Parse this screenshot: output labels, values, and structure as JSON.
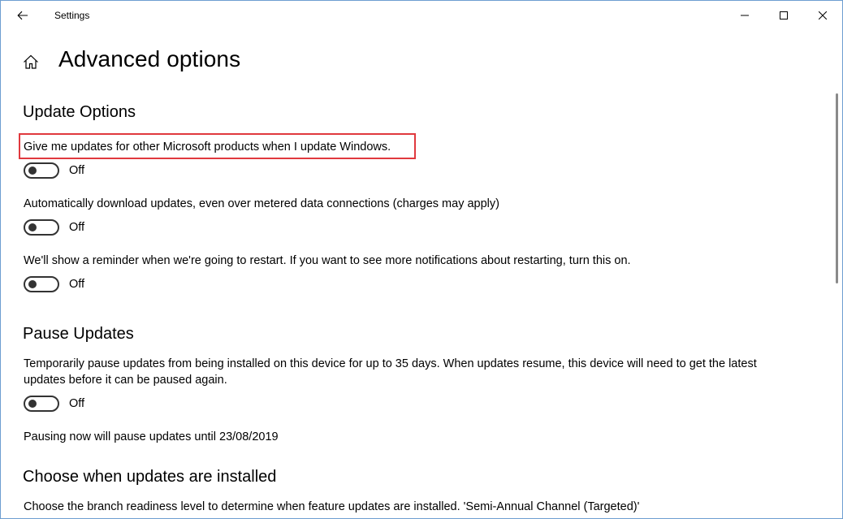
{
  "window": {
    "app_title": "Settings"
  },
  "header": {
    "title": "Advanced options"
  },
  "update_options": {
    "title": "Update Options",
    "items": [
      {
        "description": "Give me updates for other Microsoft products when I update Windows.",
        "state": "Off"
      },
      {
        "description": "Automatically download updates, even over metered data connections (charges may apply)",
        "state": "Off"
      },
      {
        "description": "We'll show a reminder when we're going to restart. If you want to see more notifications about restarting, turn this on.",
        "state": "Off"
      }
    ]
  },
  "pause_updates": {
    "title": "Pause Updates",
    "description_line1": "Temporarily pause updates from being installed on this device for up to 35 days. When updates resume, this device will need to get the latest",
    "description_line2": "updates before it can be paused again.",
    "state": "Off",
    "note": "Pausing now will pause updates until 23/08/2019"
  },
  "choose_when": {
    "title": "Choose when updates are installed",
    "description": "Choose the branch readiness level to determine when feature updates are installed. 'Semi-Annual Channel (Targeted)'"
  },
  "colors": {
    "highlight": "#e0393e",
    "toggle_off": "#333333"
  },
  "icons": {
    "back": "back-arrow-icon",
    "home": "home-icon",
    "minimize": "minimize-icon",
    "maximize": "maximize-icon",
    "close": "close-icon"
  }
}
